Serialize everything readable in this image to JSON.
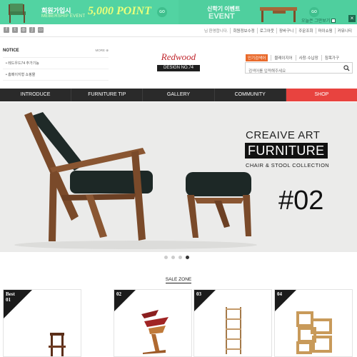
{
  "top_banner": {
    "promo_join": {
      "line1": "회원가입시",
      "line2": "MEBERSHIP EVENT",
      "points": "5,000 POINT",
      "go": "GO"
    },
    "promo_semester": {
      "line1": "신학기 이벤트",
      "line2": "EVENT",
      "go": "GO"
    },
    "dismiss_label": "오늘은 그만보기",
    "close_label": "×",
    "bg_color": "#52d3a2"
  },
  "utility": {
    "social_icons": [
      "facebook-icon",
      "twitter-icon",
      "instagram-icon",
      "kakaostory-icon",
      "blog-icon"
    ],
    "links": [
      "님 환영합니다.",
      "회원정보수정",
      "로그아웃",
      "장바구니",
      "주문조회",
      "마이쇼핑",
      "커뮤니티"
    ]
  },
  "notice": {
    "title": "NOTICE",
    "more": "MORE ⊕",
    "items": [
      "레드우드74 추가기능",
      "홈페이지형 쇼핑몰"
    ]
  },
  "logo": {
    "script": "Redwood",
    "bar": "DESIGN NO.74"
  },
  "search": {
    "popular_badge": "인기검색어",
    "keywords": [
      "블레이지어",
      "사창·수납장",
      "침목가구"
    ],
    "placeholder": "검색어를 입력해주세요"
  },
  "nav": {
    "items": [
      "INTRODUCE",
      "FURNITURE TIP",
      "GALLERY",
      "COMMUNITY",
      "SHOP"
    ],
    "active_color": "#e8433f"
  },
  "hero": {
    "line1": "CREAIVE ART",
    "line2": "FURNITURE",
    "line3": "CHAIR & STOOL COLLECTION",
    "number": "#02",
    "slides": 4,
    "active_slide": 4
  },
  "sale_zone": {
    "title": "SALE ZONE"
  },
  "products": [
    {
      "badge": "Best\n01"
    },
    {
      "badge": "02"
    },
    {
      "badge": "03"
    },
    {
      "badge": "04"
    }
  ]
}
